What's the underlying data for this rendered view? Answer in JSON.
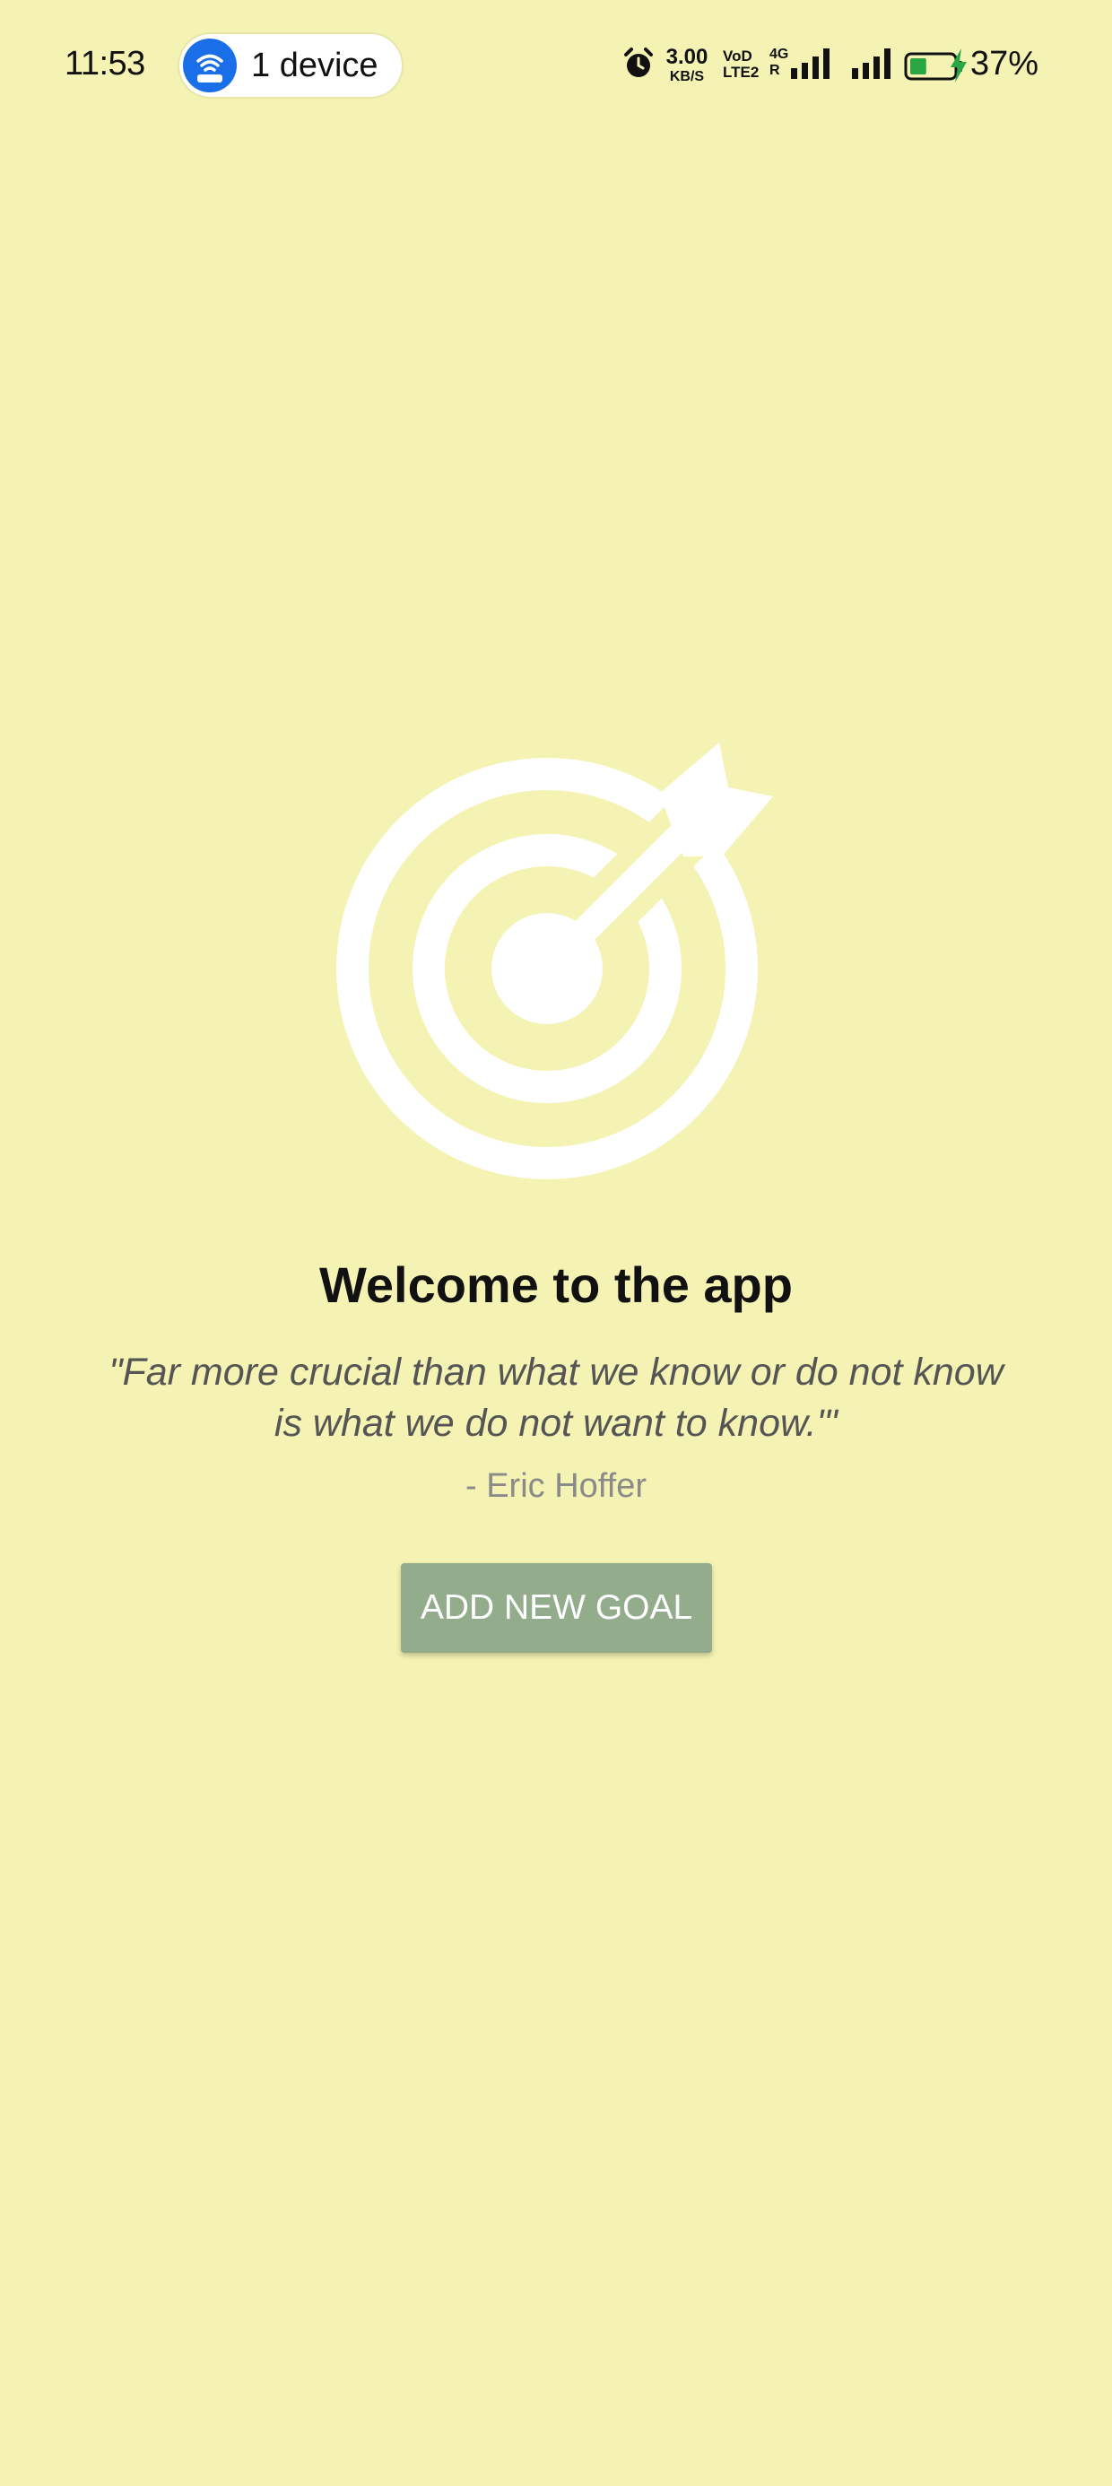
{
  "status_bar": {
    "time": "11:53",
    "hotspot_pill": {
      "label": "1 device",
      "icon": "wifi-hotspot-icon",
      "icon_color": "#1a6fe8"
    },
    "alarm_icon": "alarm-clock-icon",
    "net_speed_value": "3.00",
    "net_speed_unit": "KB/S",
    "volte_top": "VoD",
    "volte_bottom": "LTE2",
    "network_type": "4G",
    "roaming_indicator": "R",
    "signal_icon": "signal-bars-icon",
    "battery_icon": "battery-icon",
    "battery_level": 0.37,
    "battery_color": "#2aa745",
    "charging_icon": "lightning-bolt-icon",
    "battery_percent": "37%"
  },
  "main": {
    "hero_icon": "target-arrow-icon",
    "title": "Welcome to the app",
    "quote": "\"Far more crucial than what we know or do not know is what we do not want to know.\"'",
    "author": "- Eric Hoffer",
    "add_goal_button_label": "ADD NEW GOAL"
  },
  "colors": {
    "background": "#f4f3b3",
    "button": "#93ac8c",
    "button_text": "#ffffff",
    "title": "#111111",
    "quote": "#555555",
    "author": "#8a8a8a"
  }
}
